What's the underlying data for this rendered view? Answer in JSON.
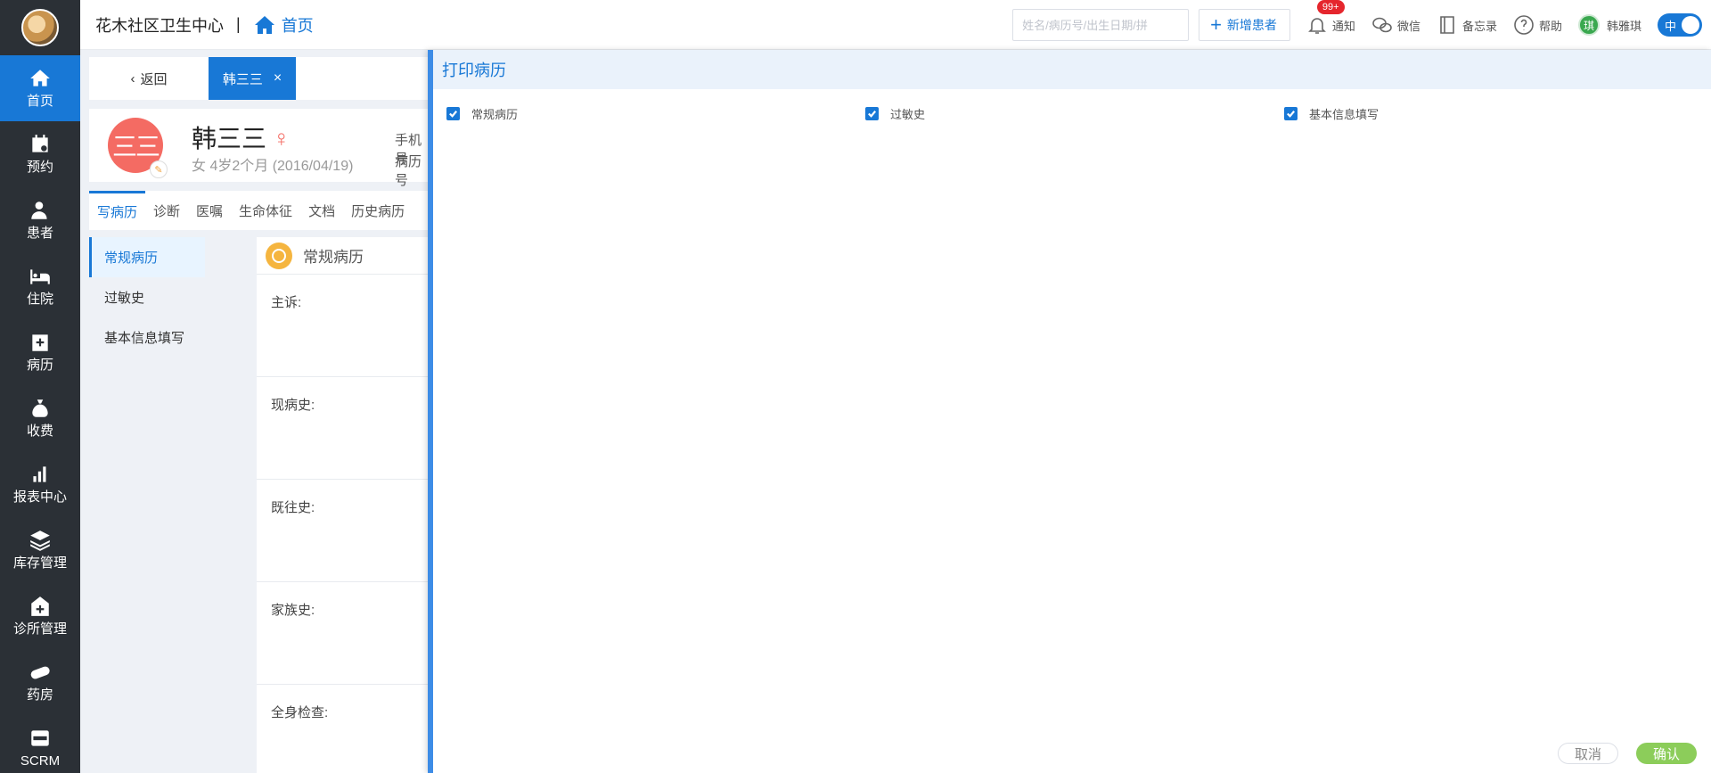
{
  "header": {
    "clinic_name": "花木社区卫生中心",
    "separator": "|",
    "home_link": "首页",
    "search_placeholder": "姓名/病历号/出生日期/拼",
    "add_patient": "新增患者",
    "notify": "通知",
    "notify_badge": "99+",
    "wechat": "微信",
    "memo": "备忘录",
    "help": "帮助",
    "user_avatar_char": "琪",
    "user_name": "韩雅琪",
    "lang": "中"
  },
  "sidebar": {
    "items": [
      {
        "label": "首页",
        "icon": "home-icon"
      },
      {
        "label": "预约",
        "icon": "calendar-icon"
      },
      {
        "label": "患者",
        "icon": "patient-icon"
      },
      {
        "label": "住院",
        "icon": "bed-icon"
      },
      {
        "label": "病历",
        "icon": "medical-record-icon"
      },
      {
        "label": "收费",
        "icon": "money-bag-icon"
      },
      {
        "label": "报表中心",
        "icon": "bar-chart-icon"
      },
      {
        "label": "库存管理",
        "icon": "layers-icon"
      },
      {
        "label": "诊所管理",
        "icon": "clinic-icon"
      },
      {
        "label": "药房",
        "icon": "pill-icon"
      },
      {
        "label": "SCRM",
        "icon": "scrm-icon"
      }
    ]
  },
  "tabs": {
    "back": "返回",
    "patient": "韩三三",
    "close": "×"
  },
  "patient": {
    "avatar_text": "三三",
    "name": "韩三三",
    "gender_symbol": "♀",
    "desc": "女  4岁2个月  (2016/04/19)",
    "phone_label": "手机号",
    "record_label": "病历号"
  },
  "subtabs": [
    "写病历",
    "诊断",
    "医嘱",
    "生命体征",
    "文档",
    "历史病历"
  ],
  "leftnav": [
    "常规病历",
    "过敏史",
    "基本信息填写"
  ],
  "form": {
    "title": "常规病历",
    "sections": [
      "主诉:",
      "现病史:",
      "既往史:",
      "家族史:",
      "全身检查:"
    ]
  },
  "modal": {
    "title": "打印病历",
    "options": [
      {
        "label": "常规病历",
        "checked": true
      },
      {
        "label": "过敏史",
        "checked": true
      },
      {
        "label": "基本信息填写",
        "checked": true
      }
    ],
    "cancel": "取消",
    "confirm": "确认"
  },
  "colors": {
    "primary": "#1878d6",
    "sidebar_bg": "#2b3036",
    "confirm_green": "#8ccd5a",
    "avatar_red": "#f46b63"
  }
}
